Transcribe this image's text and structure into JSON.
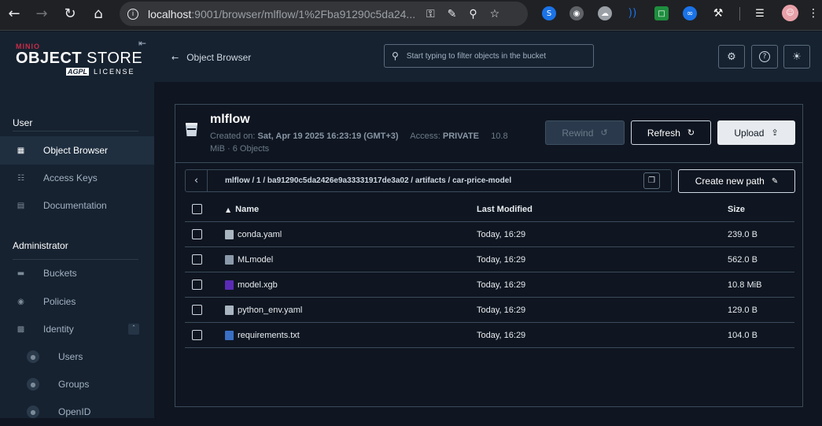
{
  "browser": {
    "url_host": "localhost",
    "url_rest": ":9001/browser/mlflow/1%2Fba91290c5da24...",
    "back_icon": "arrow-left-icon",
    "forward_icon": "arrow-right-icon",
    "reload_icon": "reload-icon",
    "home_icon": "home-icon"
  },
  "logo": {
    "brand": "MINIO",
    "main_bold": "OBJECT",
    "main_light": " STORE",
    "edition": "AGPL",
    "license": "LICENSE"
  },
  "sidebar": {
    "user_section": "User",
    "user_items": [
      {
        "label": "Object Browser",
        "icon": "object-browser-icon",
        "active": true
      },
      {
        "label": "Access Keys",
        "icon": "access-keys-icon",
        "active": false
      },
      {
        "label": "Documentation",
        "icon": "documentation-icon",
        "active": false
      }
    ],
    "admin_section": "Administrator",
    "admin_items": [
      {
        "label": "Buckets",
        "icon": "buckets-icon"
      },
      {
        "label": "Policies",
        "icon": "policies-icon"
      },
      {
        "label": "Identity",
        "icon": "identity-icon"
      }
    ],
    "identity_sub": [
      {
        "label": "Users",
        "icon": "users-icon"
      },
      {
        "label": "Groups",
        "icon": "groups-icon"
      },
      {
        "label": "OpenID",
        "icon": "openid-icon"
      }
    ]
  },
  "topbar": {
    "back_label": "Object Browser",
    "filter_placeholder": "Start typing to filter objects in the bucket"
  },
  "bucket": {
    "name": "mlflow",
    "created_label": "Created on:",
    "created_value": "Sat, Apr 19 2025 16:23:19 (GMT+3)",
    "access_label": "Access:",
    "access_value": "PRIVATE",
    "size": "10.8",
    "size_rest": "MiB · 6 Objects"
  },
  "actions": {
    "rewind": "Rewind",
    "refresh": "Refresh",
    "upload": "Upload",
    "create_new_path": "Create new path"
  },
  "breadcrumb": "mlflow / 1 / ba91290c5da2426e9a33331917de3a02 / artifacts / car-price-model",
  "table": {
    "headers": {
      "name": "Name",
      "modified": "Last Modified",
      "size": "Size"
    },
    "rows": [
      {
        "name": "conda.yaml",
        "modified": "Today, 16:29",
        "size": "239.0 B",
        "icon": "yaml-file-icon"
      },
      {
        "name": "MLmodel",
        "modified": "Today, 16:29",
        "size": "562.0 B",
        "icon": "file-icon"
      },
      {
        "name": "model.xgb",
        "modified": "Today, 16:29",
        "size": "10.8 MiB",
        "icon": "binary-file-icon"
      },
      {
        "name": "python_env.yaml",
        "modified": "Today, 16:29",
        "size": "129.0 B",
        "icon": "yaml-file-icon"
      },
      {
        "name": "requirements.txt",
        "modified": "Today, 16:29",
        "size": "104.0 B",
        "icon": "text-file-icon"
      }
    ]
  }
}
